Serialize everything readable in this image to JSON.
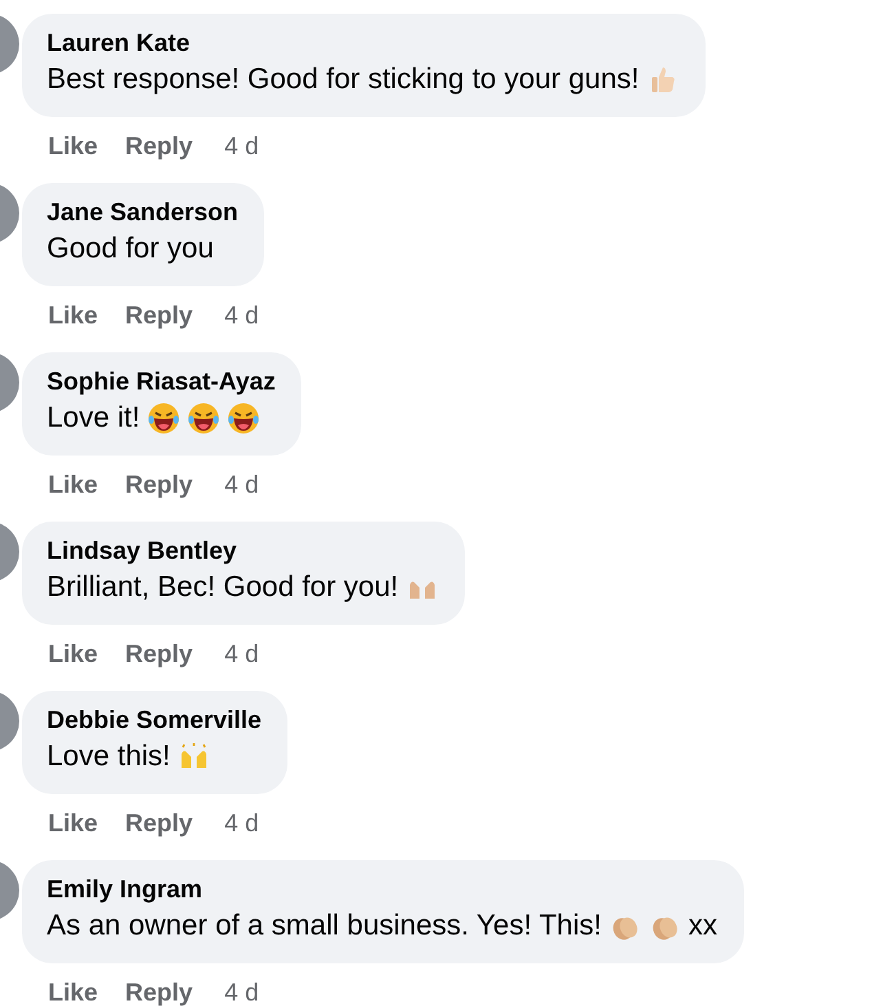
{
  "comments": [
    {
      "author": "Lauren Kate",
      "text": "Best response! Good for sticking to your guns!",
      "emojis": [
        {
          "kind": "thumbs-up"
        }
      ],
      "actions": [
        "Like",
        "Reply"
      ],
      "time": "4 d"
    },
    {
      "author": "Jane Sanderson",
      "text": "Good for you",
      "actions": [
        "Like",
        "Reply"
      ],
      "time": "4 d"
    },
    {
      "author": "Sophie Riasat-Ayaz",
      "text": "Love it!",
      "emojis": [
        {
          "kind": "laughing"
        },
        {
          "kind": "laughing"
        },
        {
          "kind": "laughing"
        }
      ],
      "actions": [
        "Like",
        "Reply"
      ],
      "time": "4 d"
    },
    {
      "author": "Lindsay Bentley",
      "text": "Brilliant, Bec! Good for you!",
      "emojis": [
        {
          "kind": "raised-hands-tan"
        }
      ],
      "actions": [
        "Like",
        "Reply"
      ],
      "time": "4 d"
    },
    {
      "author": "Debbie Somerville",
      "text": "Love this!",
      "emojis": [
        {
          "kind": "raised-hands"
        }
      ],
      "actions": [
        "Like",
        "Reply"
      ],
      "time": "4 d"
    },
    {
      "author": "Emily Ingram",
      "text": "As an owner of a small business. Yes! This!",
      "emojis": [
        {
          "kind": "clapping"
        },
        {
          "kind": "clapping"
        }
      ],
      "suffix": "xx",
      "actions": [
        "Like",
        "Reply"
      ],
      "time": "4 d"
    }
  ]
}
